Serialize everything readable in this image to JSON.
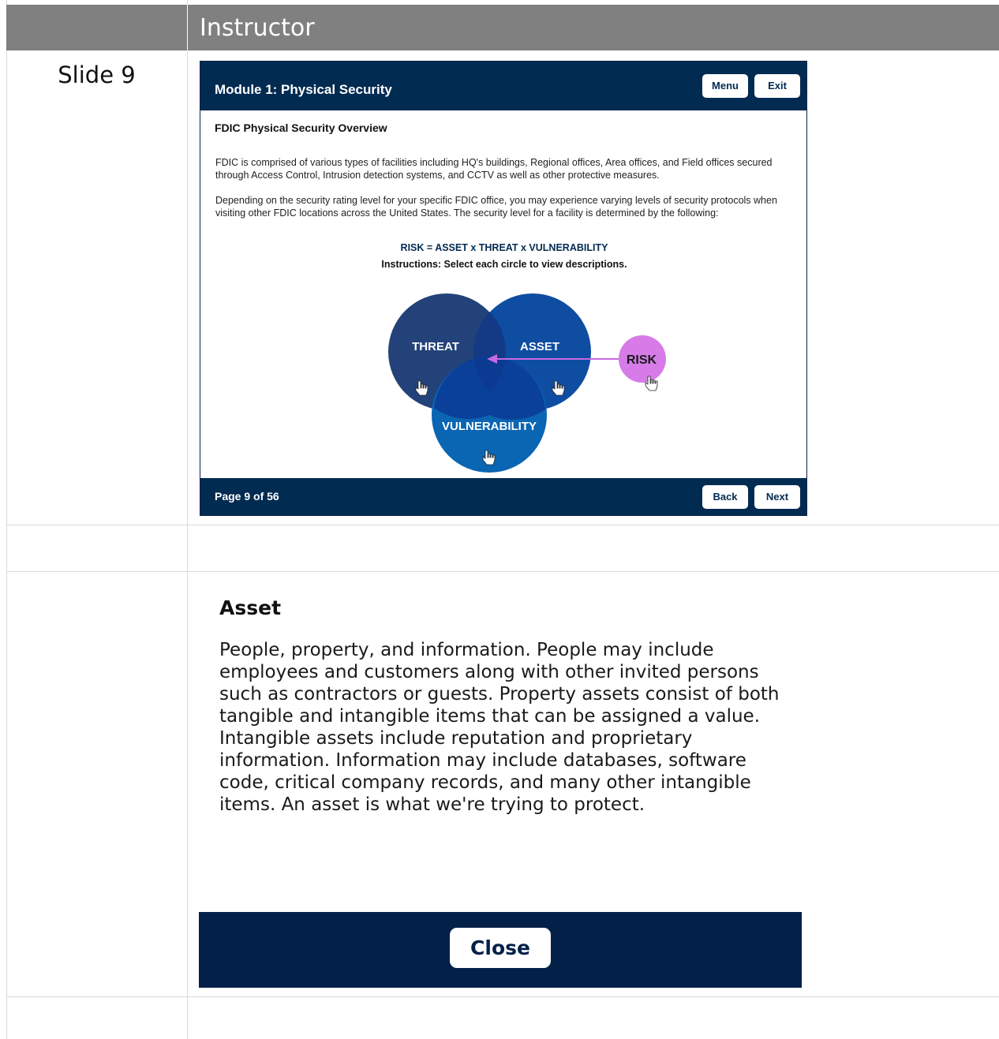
{
  "header": {
    "column_title": "Instructor"
  },
  "row_label": "Slide 9",
  "slide": {
    "module_title": "Module 1: Physical Security",
    "menu_label": "Menu",
    "exit_label": "Exit",
    "overview_title": "FDIC Physical Security Overview",
    "paragraph1": "FDIC is comprised of various types of facilities including HQ's buildings, Regional offices, Area offices, and Field offices secured through Access Control, Intrusion detection systems, and CCTV as well as other protective measures.",
    "paragraph2": "Depending on the security rating level for your specific FDIC office, you may experience varying levels of security protocols when visiting other FDIC locations across the United States.  The security level for a facility is determined by the following:",
    "formula": "RISK = ASSET x THREAT x VULNERABILITY",
    "instructions": "Instructions: Select each circle to view descriptions.",
    "venn": {
      "threat_label": "THREAT",
      "asset_label": "ASSET",
      "vulnerability_label": "VULNERABILITY",
      "risk_label": "RISK",
      "colors": {
        "threat": "#23427a",
        "asset": "#0f4da3",
        "vulnerability": "#0a65b3",
        "risk": "#d67be8",
        "arrow": "#c56ae0"
      }
    },
    "page_count": "Page 9 of 56",
    "back_label": "Back",
    "next_label": "Next"
  },
  "popup": {
    "title": "Asset",
    "body": "People, property, and information.  People may include employees and customers along with other invited persons such as contractors or guests.  Property assets consist of both tangible and intangible items that can be assigned a value.  Intangible assets include reputation and proprietary information.  Information may include databases, software code, critical company records, and many other intangible items. An asset is what we're trying to protect.",
    "close_label": "Close"
  }
}
